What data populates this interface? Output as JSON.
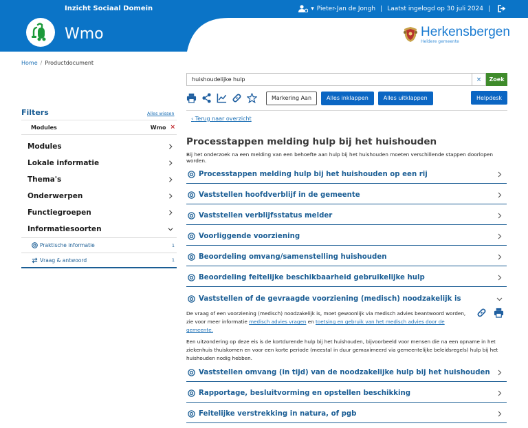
{
  "header": {
    "org_title": "Inzicht Sociaal Domein",
    "app_name": "Wmo",
    "user": "Pieter-Jan de Jongh",
    "last_login": "Laatst ingelogd op 30 juli 2024",
    "gemeente_name": "Herkensbergen",
    "gemeente_tagline": "Heldere gemeente"
  },
  "breadcrumb": {
    "home": "Home",
    "separator": "/",
    "current": "Productdocument"
  },
  "search": {
    "value": "huishoudelijke hulp",
    "clear": "×",
    "button": "Zoek"
  },
  "toolbar": {
    "markering": "Markering Aan",
    "collapse_all": "Alles inklappen",
    "expand_all": "Alles uitklappen",
    "help": "Helpdesk"
  },
  "sidebar": {
    "filters_title": "Filters",
    "clear_all": "Alles wissen",
    "active_filter": {
      "label": "Modules",
      "value": "Wmo",
      "remove": "×"
    },
    "items": [
      {
        "label": "Modules"
      },
      {
        "label": "Lokale informatie"
      },
      {
        "label": "Thema's"
      },
      {
        "label": "Onderwerpen"
      },
      {
        "label": "Functiegroepen"
      },
      {
        "label": "Informatiesoorten"
      }
    ],
    "sub_items": [
      {
        "label": "Praktische informatie",
        "count": "1"
      },
      {
        "label": "Vraag & antwoord",
        "count": "1"
      }
    ]
  },
  "main": {
    "back_link": "Terug naar overzicht",
    "title": "Processtappen melding hulp bij het huishouden",
    "intro": "Bij het onderzoek na een melding van een behoefte aan hulp bij het huishouden moeten verschillende stappen doorlopen worden.",
    "sections": [
      {
        "label": "Processtappen melding hulp bij het huishouden op een rij"
      },
      {
        "label": "Vaststellen hoofdverblijf in de gemeente"
      },
      {
        "label": "Vaststellen verblijfsstatus melder"
      },
      {
        "label": "Voorliggende voorziening"
      },
      {
        "label": "Beoordeling omvang/samenstelling huishouden"
      },
      {
        "label": "Beoordeling feitelijke beschikbaarheid gebruikelijke hulp"
      },
      {
        "label": "Vaststellen of de gevraagde voorziening (medisch) noodzakelijk is"
      },
      {
        "label": "Vaststellen omvang (in tijd) van de noodzakelijke hulp bij het huishouden"
      },
      {
        "label": "Rapportage, besluitvorming en opstellen beschikking"
      },
      {
        "label": "Feitelijke verstrekking in natura, of pgb"
      }
    ],
    "open_section": {
      "p1_start": "De vraag of een voorziening (medisch) noodzakelijk is, moet gewoonlijk via medisch advies beantwoord worden, zie voor meer informatie ",
      "p1_link1": "medisch advies vragen",
      "p1_mid": " en ",
      "p1_link2": "toetsing en gebruik van het medisch advies door de gemeente.",
      "p2": "Een uitzondering op deze eis is de kortdurende hulp bij het huishouden, bijvoorbeeld voor mensen die na een opname in het ziekenhuis thuiskomen en voor een korte periode (meestal in duur gemaximeerd via gemeentelijke beleidsregels) hulp bij het huishouden nodig hebben."
    }
  },
  "colors": {
    "header_blue": "#0b74c7",
    "accent_blue": "#1a5d94",
    "search_green": "#3f8b2b",
    "link_blue": "#1a6fb5"
  }
}
